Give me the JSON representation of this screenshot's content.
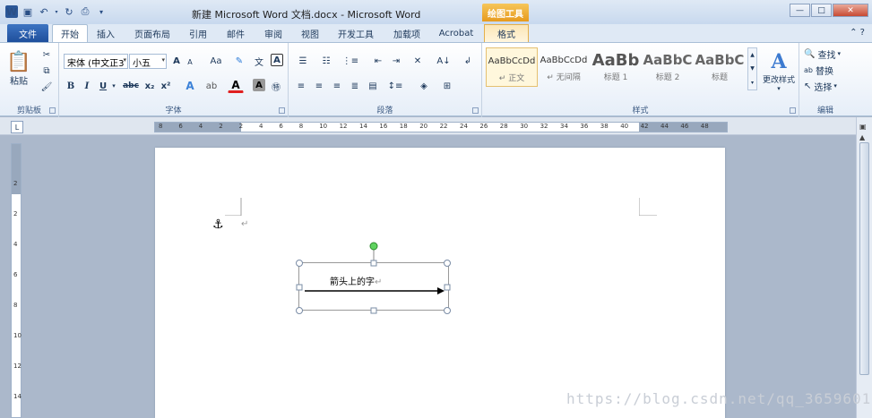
{
  "title_bar": {
    "document_title": "新建 Microsoft Word 文档.docx - Microsoft Word",
    "context_tab": "绘图工具",
    "window_controls": [
      "—",
      "□",
      "✕"
    ]
  },
  "tabs": [
    {
      "label": "文件"
    },
    {
      "label": "开始"
    },
    {
      "label": "插入"
    },
    {
      "label": "页面布局"
    },
    {
      "label": "引用"
    },
    {
      "label": "邮件"
    },
    {
      "label": "审阅"
    },
    {
      "label": "视图"
    },
    {
      "label": "开发工具"
    },
    {
      "label": "加载项"
    },
    {
      "label": "Acrobat"
    },
    {
      "label": "格式"
    }
  ],
  "ribbon": {
    "clipboard": {
      "label": "剪贴板",
      "paste_label": "粘贴"
    },
    "font": {
      "label": "字体",
      "font_name": "宋体 (中文正3",
      "font_size": "小五",
      "grow": "A",
      "shrink": "A",
      "case": "Aa",
      "bold": "B",
      "italic": "I",
      "underline": "U",
      "strike": "abc",
      "sub": "x₂",
      "sup": "x²"
    },
    "paragraph": {
      "label": "段落"
    },
    "styles": {
      "label": "样式",
      "items": [
        {
          "sample": "AaBbCcDd",
          "name": "↵ 正文"
        },
        {
          "sample": "AaBbCcDd",
          "name": "↵ 无间隔"
        },
        {
          "sample": "AaBb",
          "name": "标题 1"
        },
        {
          "sample": "AaBbC",
          "name": "标题 2"
        },
        {
          "sample": "AaBbC",
          "name": "标题"
        }
      ],
      "change_styles": "更改样式"
    },
    "editing": {
      "label": "编辑",
      "find": "查找",
      "replace": "替换",
      "select": "选择"
    }
  },
  "ruler": {
    "h_numbers": [
      "8",
      "6",
      "4",
      "2",
      "2",
      "4",
      "6",
      "8",
      "10",
      "12",
      "14",
      "16",
      "18",
      "20",
      "22",
      "24",
      "26",
      "28",
      "30",
      "32",
      "34",
      "36",
      "38",
      "40",
      "42",
      "44",
      "46",
      "48"
    ],
    "v_numbers": [
      "2",
      "2",
      "4",
      "6",
      "8",
      "10",
      "12",
      "14"
    ]
  },
  "document": {
    "textbox_text": "箭头上的字",
    "paragraph_mark": "↵"
  },
  "watermark": "https://blog.csdn.net/qq_36596013"
}
